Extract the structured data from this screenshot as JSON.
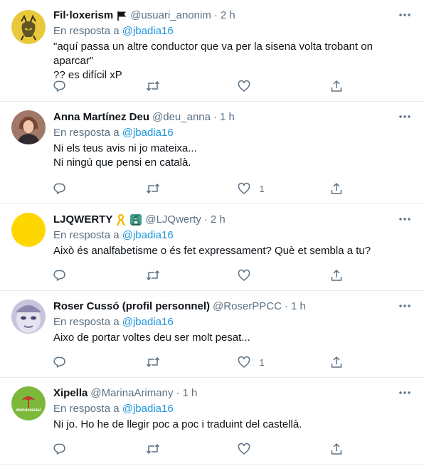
{
  "tweets": [
    {
      "name": "Fil·loxerism",
      "handle": "@usuari_anonim",
      "time": "2 h",
      "reply_prefix": "En resposta a",
      "reply_mention": "@jbadia16",
      "lines": [
        "\"aquí passa un altre conductor que va per la sisena volta trobant on aparcar\"",
        "?? es difícil xP"
      ],
      "likes": ""
    },
    {
      "name": "Anna Martínez Deu",
      "handle": "@deu_anna",
      "time": "1 h",
      "reply_prefix": "En resposta a",
      "reply_mention": "@jbadia16",
      "lines": [
        "Ni els teus avis ni jo mateixa...",
        "Ni ningú que pensi en català."
      ],
      "likes": "1"
    },
    {
      "name": "LJQWERTY",
      "handle": "@LJQwerty",
      "time": "2 h",
      "reply_prefix": "En resposta a",
      "reply_mention": "@jbadia16",
      "lines": [
        "Això és analfabetisme o és fet expressament? Què et sembla a tu?"
      ],
      "likes": ""
    },
    {
      "name": "Roser Cussó (profil personnel)",
      "handle": "@RoserPPCC",
      "time": "1 h",
      "reply_prefix": "En resposta a",
      "reply_mention": "@jbadia16",
      "lines": [
        "Aixo de portar voltes deu ser molt pesat..."
      ],
      "likes": "1"
    },
    {
      "name": "Xipella",
      "handle": "@MarinaArimany",
      "time": "1 h",
      "reply_prefix": "En resposta a",
      "reply_mention": "@jbadia16",
      "lines": [
        "Ni jo. Ho he de llegir poc a poc i traduint del castellà."
      ],
      "logo_text": "democràcia!",
      "likes": ""
    }
  ],
  "colors": {
    "accent": "#1b95e0",
    "secondary_text": "#5b7083",
    "divider": "#e6ecf0"
  },
  "icons": [
    "reply-icon",
    "retweet-icon",
    "like-icon",
    "share-icon",
    "more-icon",
    "flag-icon",
    "ribbon-icon",
    "statue-icon"
  ]
}
